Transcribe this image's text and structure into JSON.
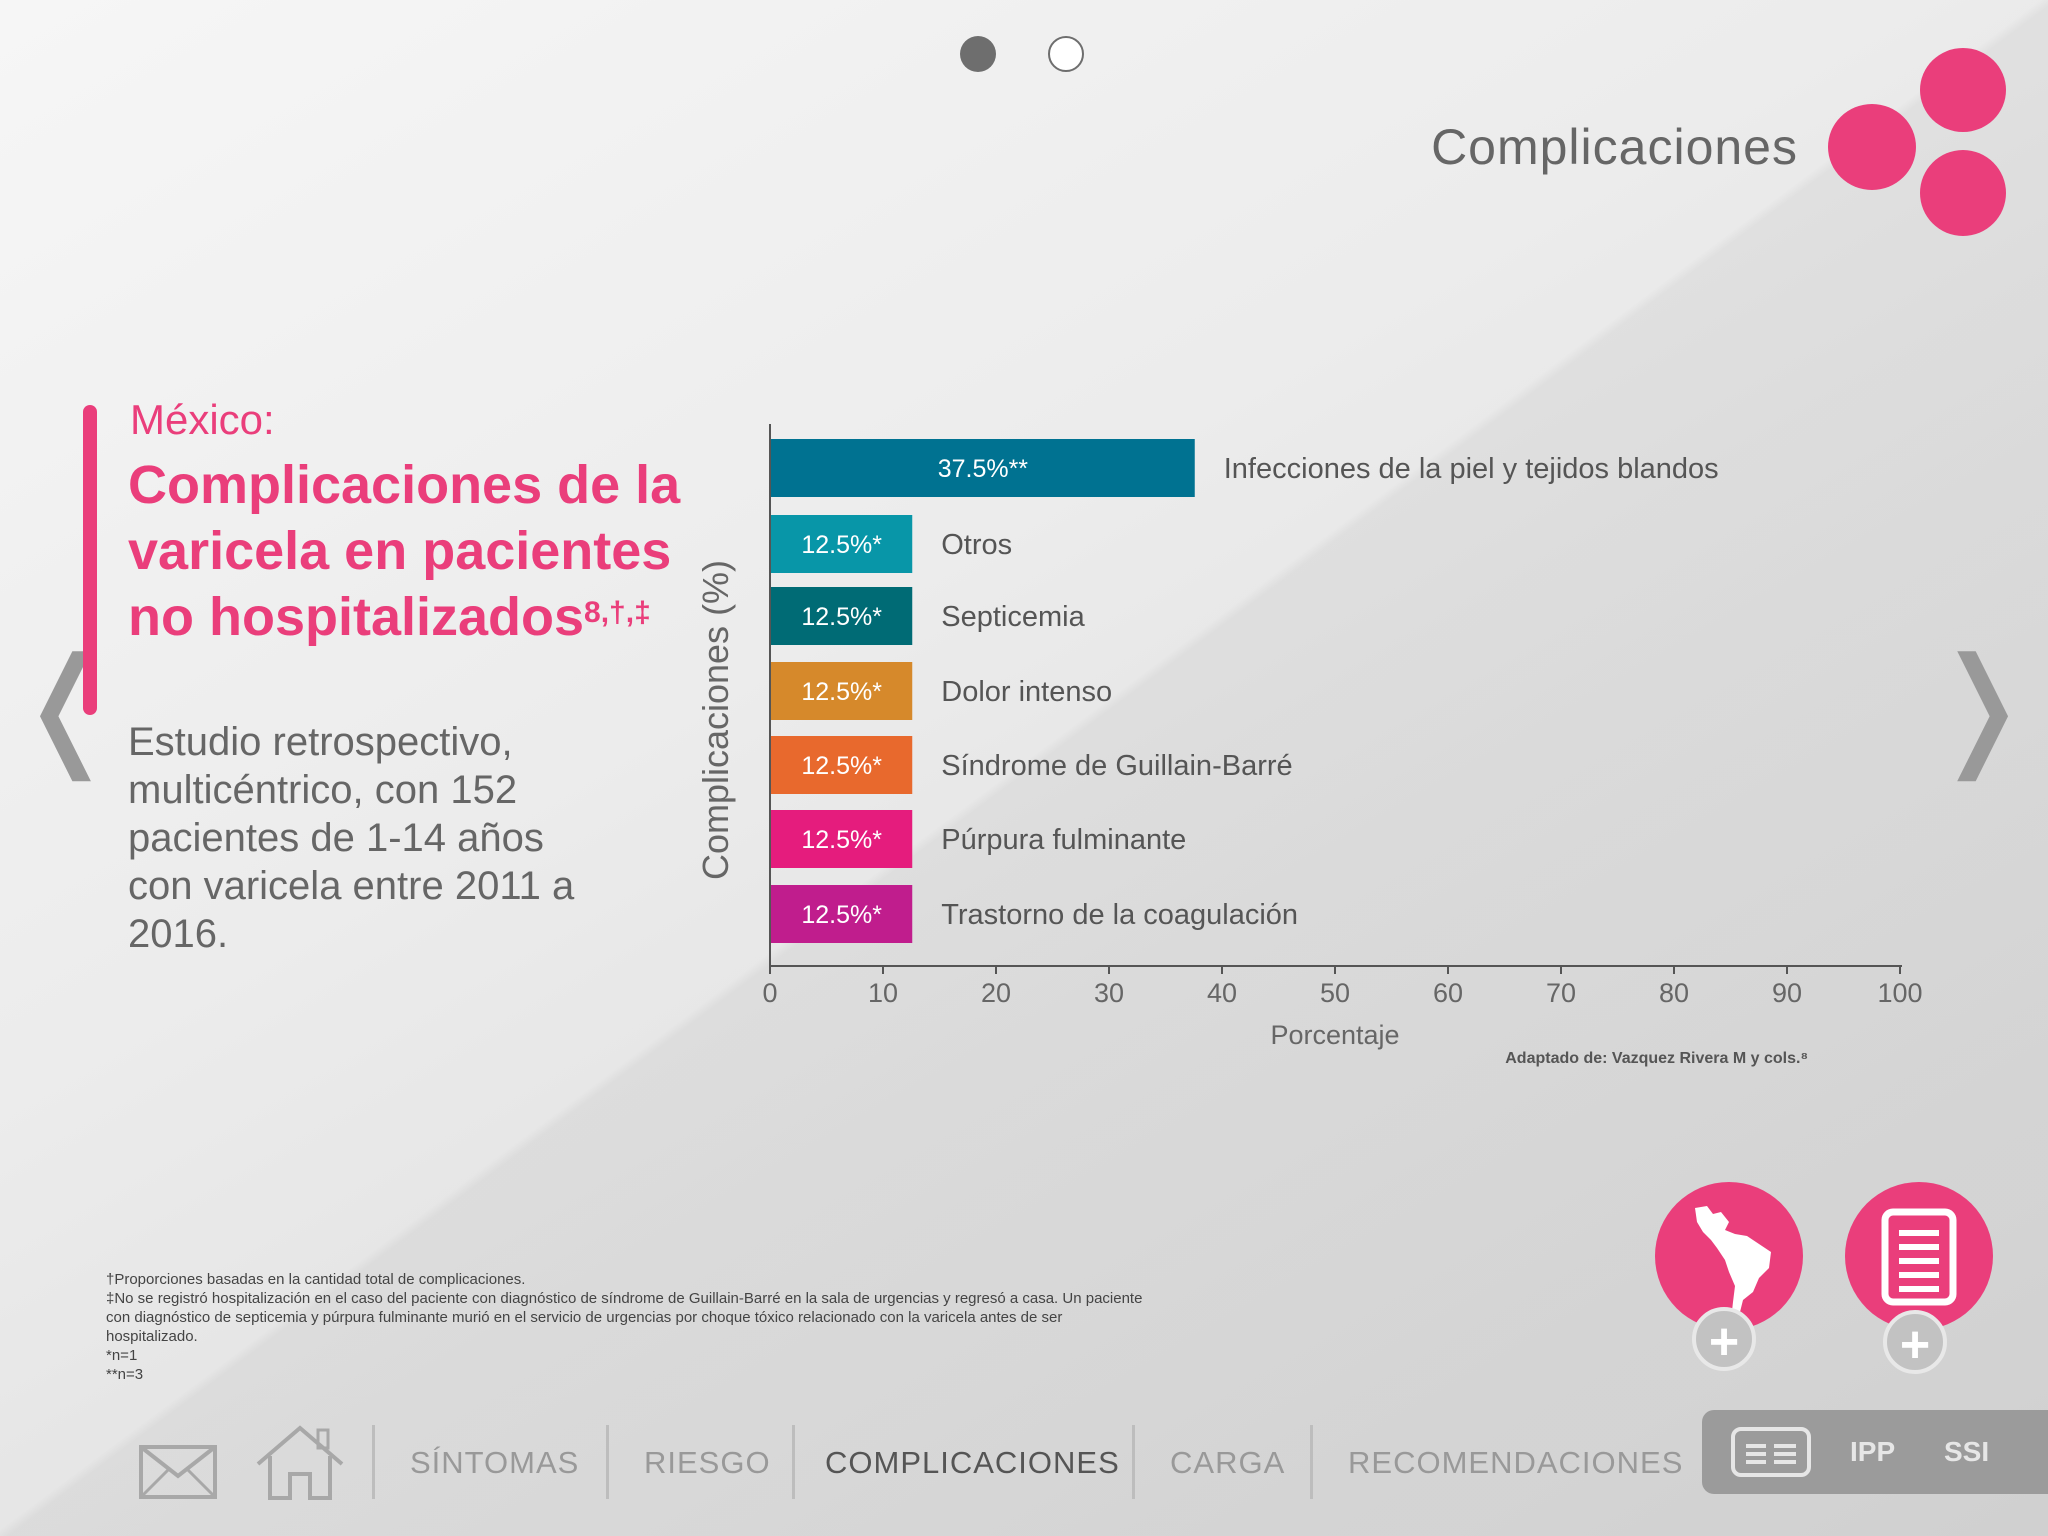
{
  "header": {
    "title": "Complicaciones",
    "pager": {
      "active_page": 1,
      "total_pages": 2
    }
  },
  "left_panel": {
    "country": "México:",
    "headline": "Complicaciones de la varicela en pacientes no hospitalizados",
    "headline_refs": "8,†,‡",
    "study": "Estudio retrospectivo, multicéntrico, con 152 pacientes de 1-14 años con varicela entre 2011 a 2016."
  },
  "chart_data": {
    "type": "bar",
    "orientation": "horizontal",
    "categories": [
      "Infecciones de la piel y tejidos blandos",
      "Otros",
      "Septicemia",
      "Dolor intenso",
      "Síndrome de Guillain-Barré",
      "Púrpura fulminante",
      "Trastorno de la coagulación"
    ],
    "values": [
      37.5,
      12.5,
      12.5,
      12.5,
      12.5,
      12.5,
      12.5
    ],
    "value_labels": [
      "37.5%**",
      "12.5%*",
      "12.5%*",
      "12.5%*",
      "12.5%*",
      "12.5%*",
      "12.5%*"
    ],
    "colors": [
      "#007291",
      "#0896a8",
      "#006b75",
      "#d6892b",
      "#e8692d",
      "#e51c7d",
      "#c01d8d"
    ],
    "xlabel": "Porcentaje",
    "ylabel": "Complicaciones (%)",
    "xlim": [
      0,
      100
    ],
    "xticks": [
      "0",
      "10",
      "20",
      "30",
      "40",
      "50",
      "60",
      "70",
      "80",
      "90",
      "100"
    ],
    "grid": false
  },
  "source": "Adaptado de: Vazquez Rivera M y cols.⁸",
  "footnotes": [
    "†Proporciones basadas en la cantidad total de complicaciones.",
    "‡No se registró hospitalización en el caso del paciente con diagnóstico de síndrome de Guillain-Barré en la sala de urgencias y regresó a casa. Un paciente con diagnóstico de septicemia y púrpura fulminante murió en el servicio de urgencias por choque tóxico relacionado con la varicela antes de ser hospitalizado.",
    "*n=1",
    "**n=3"
  ],
  "fabs": {
    "map_icon": "latin-america-map-icon",
    "doc_icon": "document-icon",
    "plus": "+"
  },
  "nav": {
    "mail_icon": "mail-icon",
    "home_icon": "home-icon",
    "items": [
      "SÍNTOMAS",
      "RIESGO",
      "COMPLICACIONES",
      "CARGA",
      "RECOMENDACIONES"
    ],
    "active": "COMPLICACIONES",
    "panel": {
      "menu_icon": "menu-icon",
      "ipp": "IPP",
      "ssi": "SSI"
    }
  },
  "colors": {
    "accent": "#ea3e7b",
    "text_gray": "#666666"
  }
}
